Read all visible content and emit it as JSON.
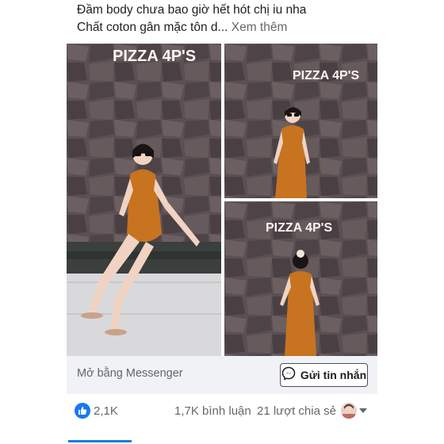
{
  "post": {
    "caption_line1": "Đầm body chưa bao giờ hết hót chị iu nha",
    "caption_line2": "Chất coton gân mặc tôn d...",
    "see_more": "Xem thêm"
  },
  "photos": [
    {
      "sign": "PIZZA 4P'S"
    },
    {
      "sign": "PIZZA 4P'S"
    },
    {
      "sign": "PIZZA 4P'S"
    }
  ],
  "messenger": {
    "open_label": "Mở bằng Messenger",
    "send_label": "Gửi tin nhắn"
  },
  "stats": {
    "likes": "2,1K",
    "comments": "1,7K bình luận",
    "shares": "21 lượt chia sẻ"
  },
  "colors": {
    "accent": "#1877f2",
    "dress": "#c8731f",
    "wall": "#5e5254"
  }
}
